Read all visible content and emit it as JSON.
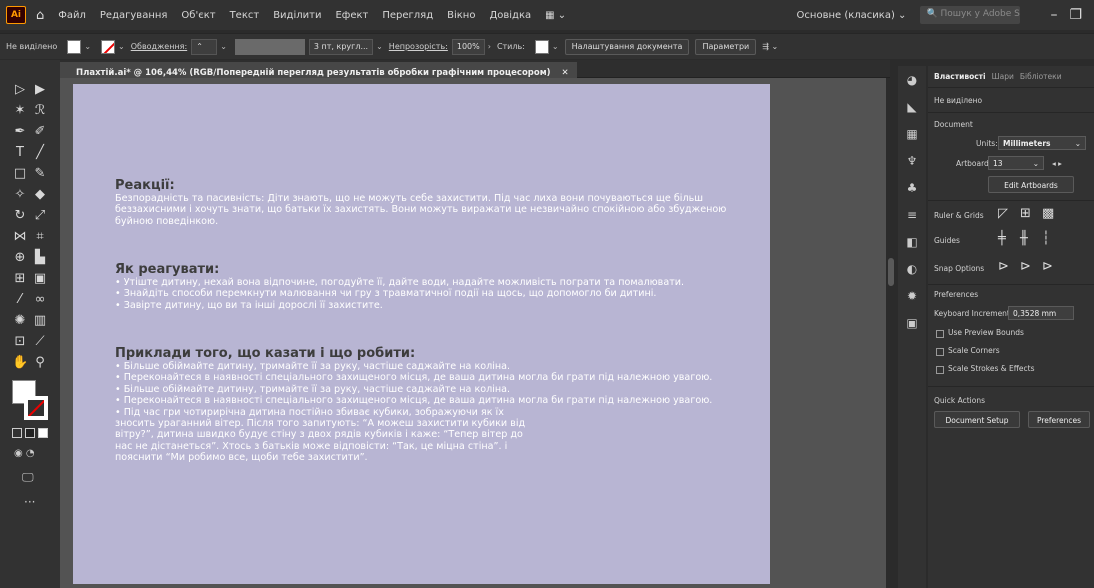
{
  "app": {
    "logo": "Ai"
  },
  "menu": [
    "Файл",
    "Редагування",
    "Об'єкт",
    "Текст",
    "Виділити",
    "Ефект",
    "Перегляд",
    "Вікно",
    "Довідка"
  ],
  "workspace": "Основне (класика)",
  "search": {
    "placeholder": "Пошук у Adobe Stock"
  },
  "control_bar": {
    "selection": "Не виділено",
    "stroke_label": "Обводження:",
    "brush": "3 пт, кругл...",
    "opacity_label": "Непрозорість:",
    "opacity_value": "100%",
    "style_label": "Стиль:",
    "doc_setup": "Налаштування документа",
    "params": "Параметри"
  },
  "document_tab": "Плахтій.ai* @ 106,44% (RGB/Попередній перегляд результатів обробки графічним процесором)",
  "artboard": {
    "sections": [
      {
        "heading": "Реакції:",
        "lines": [
          "Безпорадність та пасивність: Діти знають, що не можуть себе захистити. Під час лиха вони почуваються ще більш",
          "беззахисними і хочуть знати, що батьки їх захистять. Вони можуть виражати це незвичайно спокійною або збудженою",
          "буйною поведінкою."
        ]
      },
      {
        "heading": "Як реагувати:",
        "lines": [
          "• Утіште дитину, нехай вона відпочине, погодуйте її, дайте води, надайте можливість пограти та помалювати.",
          "• Знайдіть способи перемкнути малювання чи гру з травматичної події на щось, що допомогло би дитині.",
          "• Завірте дитину, що ви та інші дорослі її захистите."
        ]
      },
      {
        "heading": "Приклади того, що казати і що робити:",
        "lines": [
          "• Більше обіймайте дитину, тримайте її за руку, частіше саджайте на коліна.",
          "• Переконайтеся в наявності спеціального захищеного місця, де ваша дитина могла би грати під належною увагою.",
          "• Більше обіймайте дитину, тримайте її за руку, частіше саджайте на коліна.",
          "• Переконайтеся в наявності спеціального захищеного місця, де ваша дитина могла би грати під належною увагою.",
          "• Під час гри чотирирічна дитина постійно збиває кубики, зображуючи як їх",
          "зносить ураганний вітер. Після того запитують: “А можеш захистити кубики від",
          "вітру?”, дитина швидко будує стіну з двох рядів кубиків і каже: “Тепер вітер до",
          "нас не дістанеться”. Хтось з батьків може відповісти: “Так, це міцна стіна”. і",
          "пояснити “Ми робимо все, щоби тебе захистити”."
        ]
      }
    ]
  },
  "props_panel": {
    "tabs": [
      "Властивості",
      "Шари",
      "Бібліотеки"
    ],
    "no_selection": "Не виділено",
    "document_label": "Document",
    "units_label": "Units:",
    "units_value": "Millimeters",
    "artboard_label": "Artboard:",
    "artboard_value": "13",
    "edit_artboards": "Edit Artboards",
    "ruler_grids": "Ruler & Grids",
    "guides": "Guides",
    "snap_options": "Snap Options",
    "preferences_label": "Preferences",
    "keyboard_increment_label": "Keyboard Increment:",
    "keyboard_increment_value": "0,3528 mm",
    "use_preview_bounds": "Use Preview Bounds",
    "scale_corners": "Scale Corners",
    "scale_strokes": "Scale Strokes & Effects",
    "quick_actions": "Quick Actions",
    "document_setup_btn": "Document Setup",
    "preferences_btn": "Preferences"
  }
}
